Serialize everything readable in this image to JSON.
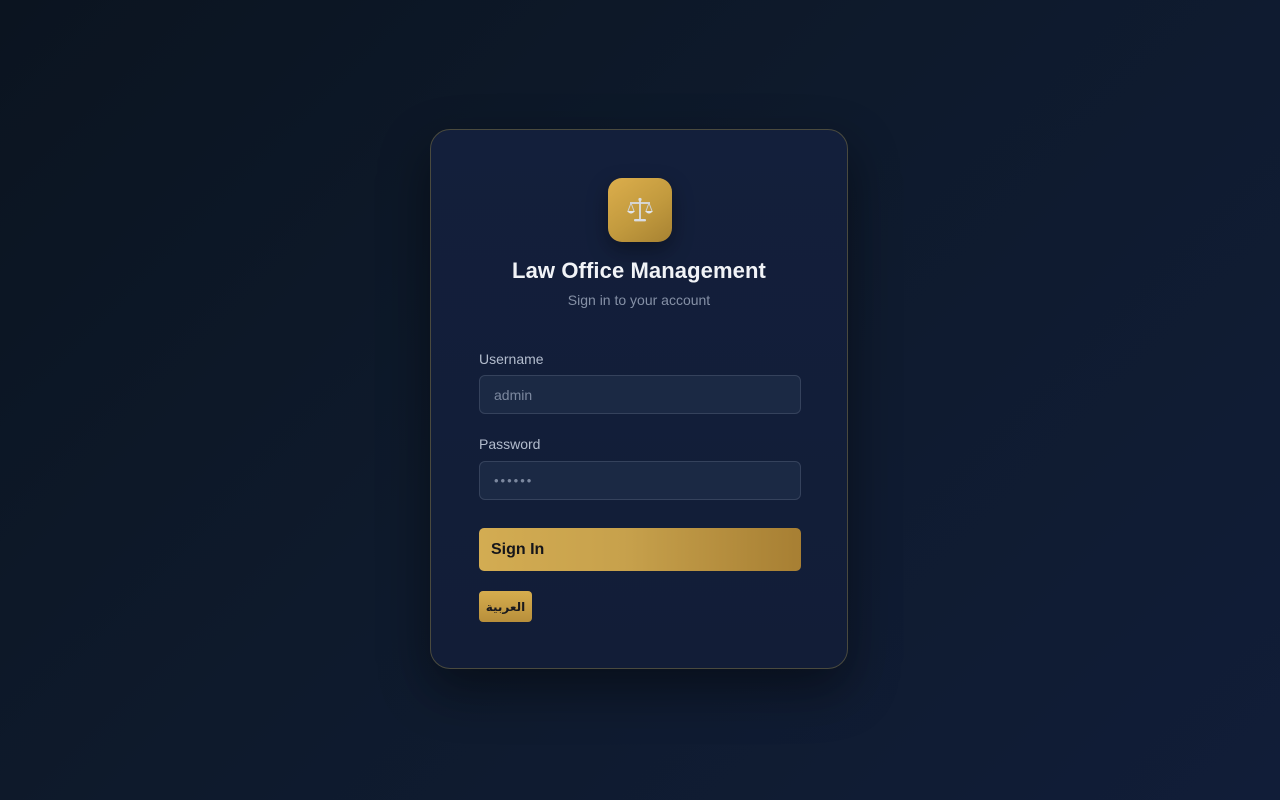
{
  "app": {
    "logo_icon": "balance-scale-icon",
    "title": "Law Office Management",
    "subtitle": "Sign in to your account"
  },
  "form": {
    "username": {
      "label": "Username",
      "placeholder": "admin",
      "value": ""
    },
    "password": {
      "label": "Password",
      "placeholder": "••••••",
      "value": ""
    },
    "submit_label": "Sign In",
    "language_toggle_label": "العربية"
  },
  "colors": {
    "accent_gold": "#c9a24a",
    "card_background": "#131f3b",
    "page_background": "#0d1828",
    "input_background": "#1b2944"
  }
}
